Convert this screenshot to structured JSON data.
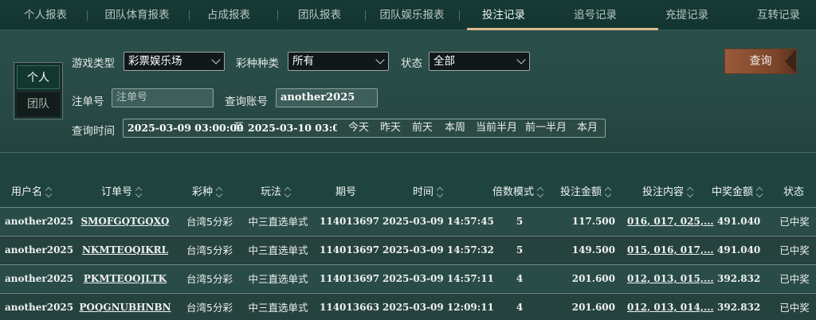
{
  "tabs": [
    {
      "label": "个人报表"
    },
    {
      "label": "团队体育报表"
    },
    {
      "label": "占成报表"
    },
    {
      "label": "团队报表"
    },
    {
      "label": "团队娱乐报表"
    },
    {
      "label": "投注记录"
    },
    {
      "label": "追号记录"
    },
    {
      "label": "充提记录"
    },
    {
      "label": "互转记录"
    }
  ],
  "scope": {
    "personal": "个人",
    "team": "团队"
  },
  "filters": {
    "game_type_label": "游戏类型",
    "game_type_value": "彩票娱乐场",
    "lottery_label": "彩种种类",
    "lottery_value": "所有",
    "status_label": "状态",
    "status_value": "全部",
    "order_label": "注单号",
    "order_placeholder": "注单号",
    "account_label": "查询账号",
    "account_value": "another2025",
    "time_label": "查询时间",
    "date_from": "2025-03-09 03:00:00",
    "date_sep": "至",
    "date_to": "2025-03-10 03:00:0",
    "quick": [
      "今天",
      "昨天",
      "前天",
      "本周",
      "当前半月",
      "前一半月",
      "本月"
    ],
    "query_button": "查询"
  },
  "table": {
    "headers": [
      "用户名",
      "订单号",
      "彩种",
      "玩法",
      "期号",
      "时间",
      "倍数模式",
      "投注金额",
      "投注内容",
      "中奖金额",
      "状态"
    ],
    "rows": [
      {
        "user": "another2025",
        "order": "SMOFGQTGQXQ",
        "lottery": "台湾5分彩",
        "play": "中三直选单式",
        "issue": "114013697",
        "time": "2025-03-09 14:57:45",
        "mode": "5",
        "amount": "117.500",
        "content": "016, 017, 025,...",
        "prize": "491.040",
        "status": "已中奖"
      },
      {
        "user": "another2025",
        "order": "NKMTEOQIKRL",
        "lottery": "台湾5分彩",
        "play": "中三直选单式",
        "issue": "114013697",
        "time": "2025-03-09 14:57:32",
        "mode": "5",
        "amount": "149.500",
        "content": "015, 016, 017,...",
        "prize": "491.040",
        "status": "已中奖"
      },
      {
        "user": "another2025",
        "order": "PKMTEOOJLTK",
        "lottery": "台湾5分彩",
        "play": "中三直选单式",
        "issue": "114013697",
        "time": "2025-03-09 14:57:11",
        "mode": "4",
        "amount": "201.600",
        "content": "012, 013, 015,...",
        "prize": "392.832",
        "status": "已中奖"
      },
      {
        "user": "another2025",
        "order": "POQGNUBHNBN",
        "lottery": "台湾5分彩",
        "play": "中三直选单式",
        "issue": "114013663",
        "time": "2025-03-09 12:09:11",
        "mode": "4",
        "amount": "201.600",
        "content": "012, 013, 014,...",
        "prize": "392.832",
        "status": "已中奖"
      }
    ]
  }
}
